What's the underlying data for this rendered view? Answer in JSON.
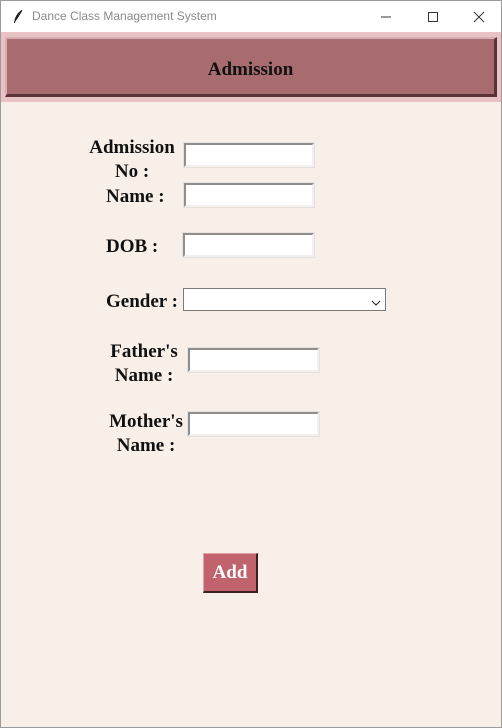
{
  "window": {
    "title": "Dance Class Management System",
    "controls": [
      "minimize",
      "maximize",
      "close"
    ]
  },
  "header": {
    "title": "Admission"
  },
  "form": {
    "admission_no": {
      "label_line1": "Admission",
      "label_line2": "No :",
      "value": ""
    },
    "name": {
      "label": "Name :",
      "value": ""
    },
    "dob": {
      "label": "DOB :",
      "value": ""
    },
    "gender": {
      "label": "Gender :",
      "value": ""
    },
    "fathers_name": {
      "label_line1": "Father's",
      "label_line2": "Name :",
      "value": ""
    },
    "mothers_name": {
      "label_line1": "Mother's",
      "label_line2": "Name :",
      "value": ""
    }
  },
  "actions": {
    "add_label": "Add"
  },
  "colors": {
    "background": "#f8efe8",
    "header_frame": "#e9c3c3",
    "header_panel": "#a86b6f",
    "button": "#c1636c"
  }
}
